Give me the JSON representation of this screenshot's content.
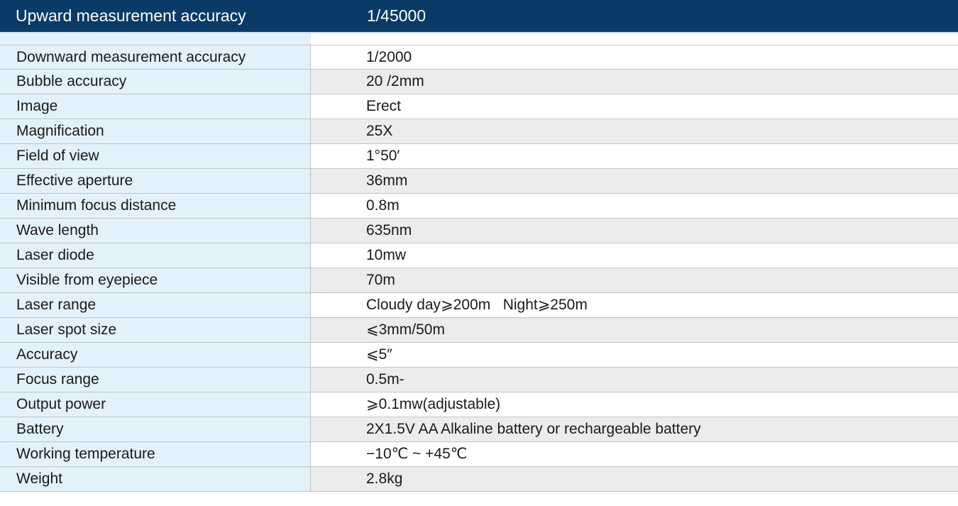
{
  "header": {
    "label": "Upward measurement accuracy",
    "value": "1/45000"
  },
  "specs": [
    {
      "label": "Downward measurement accuracy",
      "value": "1/2000"
    },
    {
      "label": "Bubble accuracy",
      "value": "20 /2mm"
    },
    {
      "label": "Image",
      "value": "Erect"
    },
    {
      "label": "Magnification",
      "value": "25X"
    },
    {
      "label": "Field of view",
      "value": "1°50′"
    },
    {
      "label": "Effective aperture",
      "value": "36mm"
    },
    {
      "label": "Minimum focus distance",
      "value": "0.8m"
    },
    {
      "label": "Wave length",
      "value": "635nm"
    },
    {
      "label": "Laser diode",
      "value": "10mw"
    },
    {
      "label": "Visible from eyepiece",
      "value": "70m"
    },
    {
      "label": "Laser range",
      "value": "Cloudy day⩾200m   Night⩾250m"
    },
    {
      "label": "Laser spot size",
      "value": "⩽3mm/50m"
    },
    {
      "label": "Accuracy",
      "value": "⩽5″"
    },
    {
      "label": "Focus range",
      "value": "0.5m-"
    },
    {
      "label": "Output power",
      "value": "⩾0.1mw(adjustable)"
    },
    {
      "label": "Battery",
      "value": "2X1.5V AA Alkaline battery or rechargeable battery"
    },
    {
      "label": "Working temperature",
      "value": "−10℃ ~ +45℃"
    },
    {
      "label": "Weight",
      "value": "2.8kg"
    }
  ],
  "colors": {
    "header_background": "#0a3a67",
    "header_text": "#ffffff",
    "label_column_background": "#e3f1fb",
    "value_row_alternate": "#ececec",
    "grid_line": "#c4c4c4"
  }
}
